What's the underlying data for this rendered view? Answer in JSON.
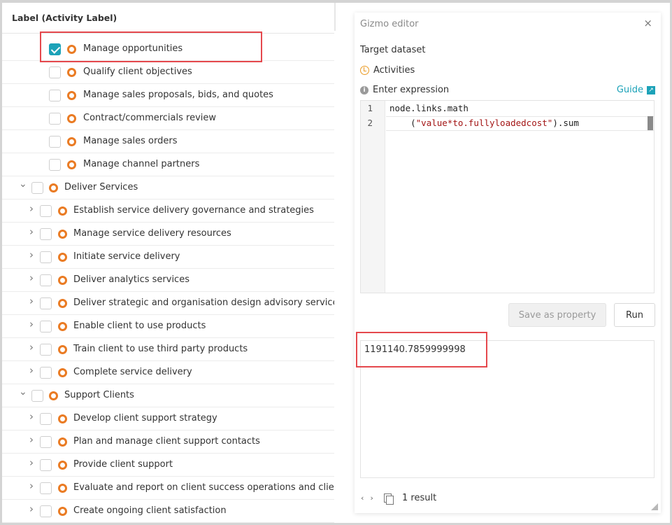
{
  "table": {
    "column_header": "Label (Activity Label)",
    "rows": [
      {
        "label": "Manage opportunities",
        "level": 2,
        "checked": true,
        "chevron": ""
      },
      {
        "label": "Qualify client objectives",
        "level": 2,
        "checked": false,
        "chevron": ""
      },
      {
        "label": "Manage sales proposals, bids, and quotes",
        "level": 2,
        "checked": false,
        "chevron": ""
      },
      {
        "label": "Contract/commercials review",
        "level": 2,
        "checked": false,
        "chevron": ""
      },
      {
        "label": "Manage sales orders",
        "level": 2,
        "checked": false,
        "chevron": ""
      },
      {
        "label": "Manage channel partners",
        "level": 2,
        "checked": false,
        "chevron": ""
      },
      {
        "label": "Deliver Services",
        "level": 0,
        "checked": false,
        "chevron": "expanded"
      },
      {
        "label": "Establish service delivery governance and strategies",
        "level": 1,
        "checked": false,
        "chevron": "collapsed"
      },
      {
        "label": "Manage service delivery resources",
        "level": 1,
        "checked": false,
        "chevron": "collapsed"
      },
      {
        "label": "Initiate service delivery",
        "level": 1,
        "checked": false,
        "chevron": "collapsed"
      },
      {
        "label": "Deliver analytics services",
        "level": 1,
        "checked": false,
        "chevron": "collapsed"
      },
      {
        "label": "Deliver strategic and organisation design advisory services",
        "level": 1,
        "checked": false,
        "chevron": "collapsed"
      },
      {
        "label": "Enable client to use products",
        "level": 1,
        "checked": false,
        "chevron": "collapsed"
      },
      {
        "label": "Train client to use third party products",
        "level": 1,
        "checked": false,
        "chevron": "collapsed"
      },
      {
        "label": "Complete service delivery",
        "level": 1,
        "checked": false,
        "chevron": "collapsed"
      },
      {
        "label": "Support Clients",
        "level": 0,
        "checked": false,
        "chevron": "expanded"
      },
      {
        "label": "Develop client support strategy",
        "level": 1,
        "checked": false,
        "chevron": "collapsed"
      },
      {
        "label": "Plan and manage client support contacts",
        "level": 1,
        "checked": false,
        "chevron": "collapsed"
      },
      {
        "label": "Provide client support",
        "level": 1,
        "checked": false,
        "chevron": "collapsed"
      },
      {
        "label": "Evaluate and report on client success operations and client",
        "level": 1,
        "checked": false,
        "chevron": "collapsed"
      },
      {
        "label": "Create ongoing client satisfaction",
        "level": 1,
        "checked": false,
        "chevron": "collapsed"
      }
    ]
  },
  "editor": {
    "title": "Gizmo editor",
    "close_symbol": "×",
    "target_label": "Target dataset",
    "dataset_name": "Activities",
    "expression_label": "Enter expression",
    "guide_label": "Guide",
    "line_numbers": [
      "1",
      "2"
    ],
    "code_line1": "node.links.math",
    "code_line2_indent": "    (",
    "code_line2_string": "\"value*to.fullyloadedcost\"",
    "code_line2_rest": ").sum",
    "save_label": "Save as property",
    "run_label": "Run",
    "result_value": "1191140.7859999998",
    "result_count": "1 result"
  },
  "colors": {
    "accent": "#1ca2b8",
    "activity_ring": "#ea7b23",
    "highlight": "#e5484d"
  }
}
